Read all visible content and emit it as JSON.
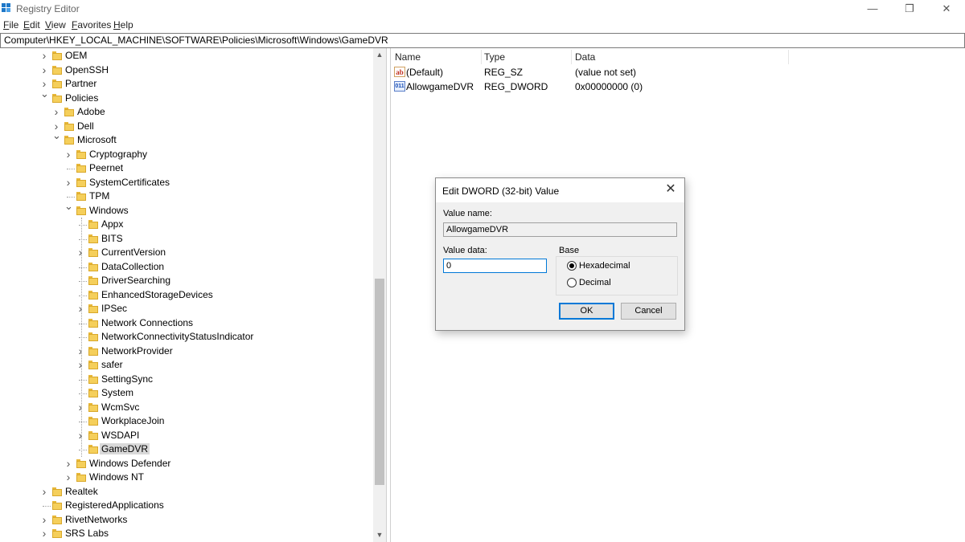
{
  "window": {
    "title": "Registry Editor",
    "controls": {
      "minimize": "—",
      "maximize": "❐",
      "close": "✕"
    }
  },
  "menu": [
    {
      "label_accel": "F",
      "label_rest": "ile"
    },
    {
      "label_accel": "E",
      "label_rest": "dit"
    },
    {
      "label_accel": "V",
      "label_rest": "iew"
    },
    {
      "label_accel": "F",
      "label_rest": "avorites"
    },
    {
      "label_accel": "H",
      "label_rest": "elp"
    }
  ],
  "address": "Computer\\HKEY_LOCAL_MACHINE\\SOFTWARE\\Policies\\Microsoft\\Windows\\GameDVR",
  "tree": [
    {
      "label": "OEM",
      "expander": ">",
      "depth": 0
    },
    {
      "label": "OpenSSH",
      "expander": ">",
      "depth": 0
    },
    {
      "label": "Partner",
      "expander": ">",
      "depth": 0
    },
    {
      "label": "Policies",
      "expander": "v",
      "depth": 0
    },
    {
      "label": "Adobe",
      "expander": ">",
      "depth": 1
    },
    {
      "label": "Dell",
      "expander": ">",
      "depth": 1
    },
    {
      "label": "Microsoft",
      "expander": "v",
      "depth": 1
    },
    {
      "label": "Cryptography",
      "expander": ">",
      "depth": 2
    },
    {
      "label": "Peernet",
      "expander": "",
      "depth": 2
    },
    {
      "label": "SystemCertificates",
      "expander": ">",
      "depth": 2
    },
    {
      "label": "TPM",
      "expander": "",
      "depth": 2
    },
    {
      "label": "Windows",
      "expander": "v",
      "depth": 2
    },
    {
      "label": "Appx",
      "expander": "",
      "depth": 3
    },
    {
      "label": "BITS",
      "expander": "",
      "depth": 3
    },
    {
      "label": "CurrentVersion",
      "expander": ">",
      "depth": 3
    },
    {
      "label": "DataCollection",
      "expander": "",
      "depth": 3
    },
    {
      "label": "DriverSearching",
      "expander": "",
      "depth": 3
    },
    {
      "label": "EnhancedStorageDevices",
      "expander": "",
      "depth": 3
    },
    {
      "label": "IPSec",
      "expander": ">",
      "depth": 3
    },
    {
      "label": "Network Connections",
      "expander": "",
      "depth": 3
    },
    {
      "label": "NetworkConnectivityStatusIndicator",
      "expander": "",
      "depth": 3
    },
    {
      "label": "NetworkProvider",
      "expander": ">",
      "depth": 3
    },
    {
      "label": "safer",
      "expander": ">",
      "depth": 3
    },
    {
      "label": "SettingSync",
      "expander": "",
      "depth": 3
    },
    {
      "label": "System",
      "expander": "",
      "depth": 3
    },
    {
      "label": "WcmSvc",
      "expander": ">",
      "depth": 3
    },
    {
      "label": "WorkplaceJoin",
      "expander": "",
      "depth": 3
    },
    {
      "label": "WSDAPI",
      "expander": ">",
      "depth": 3
    },
    {
      "label": "GameDVR",
      "expander": "",
      "depth": 3,
      "selected": true
    },
    {
      "label": "Windows Defender",
      "expander": ">",
      "depth": 2
    },
    {
      "label": "Windows NT",
      "expander": ">",
      "depth": 2
    },
    {
      "label": "Realtek",
      "expander": ">",
      "depth": 0
    },
    {
      "label": "RegisteredApplications",
      "expander": "",
      "depth": 0
    },
    {
      "label": "RivetNetworks",
      "expander": ">",
      "depth": 0
    },
    {
      "label": "SRS Labs",
      "expander": ">",
      "depth": 0
    }
  ],
  "list": {
    "columns": [
      "Name",
      "Type",
      "Data"
    ],
    "rows": [
      {
        "icon": "string-value-icon",
        "icon_text": "ab",
        "name": "(Default)",
        "type": "REG_SZ",
        "data": "(value not set)"
      },
      {
        "icon": "dword-value-icon",
        "icon_text": "011",
        "name": "AllowgameDVR",
        "type": "REG_DWORD",
        "data": "0x00000000 (0)"
      }
    ]
  },
  "dialog": {
    "title": "Edit DWORD (32-bit) Value",
    "value_name_label": "Value name:",
    "value_name": "AllowgameDVR",
    "value_data_label": "Value data:",
    "value_data": "0",
    "base_label": "Base",
    "radio_hex": "Hexadecimal",
    "radio_dec": "Decimal",
    "selected_base": "Hexadecimal",
    "ok_label": "OK",
    "cancel_label": "Cancel"
  }
}
